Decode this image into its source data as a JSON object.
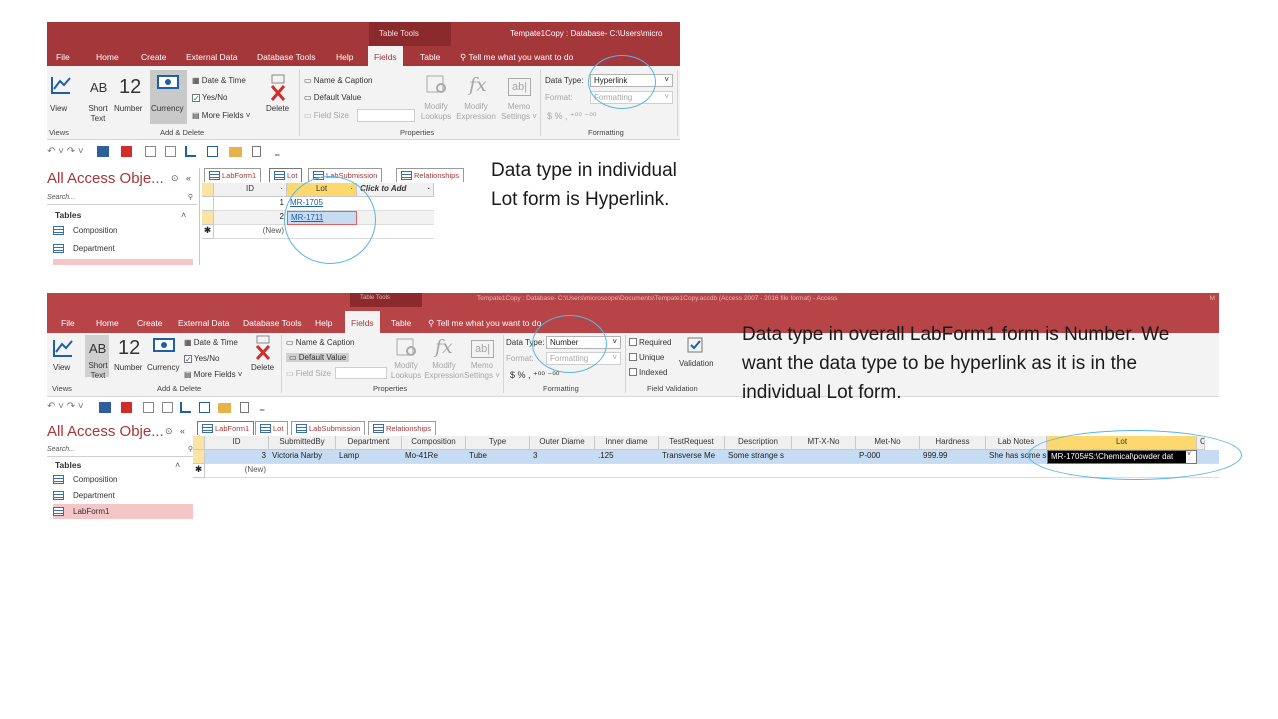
{
  "shot1": {
    "titlebar": {
      "table_tools": "Table Tools",
      "window_title": "Tempate1Copy : Database- C:\\Users\\micro"
    },
    "tabs": [
      "File",
      "Home",
      "Create",
      "External Data",
      "Database Tools",
      "Help",
      "Fields",
      "Table"
    ],
    "active_tab": "Fields",
    "tell_me": "Tell me what you want to do",
    "ribbon": {
      "view": "View",
      "short_text_ab": "AB",
      "short_text": "Short Text",
      "number_12": "12",
      "number": "Number",
      "currency": "Currency",
      "date_time": "Date & Time",
      "yes_no": "Yes/No",
      "more_fields": "More Fields ˅",
      "delete": "Delete",
      "name_caption": "Name & Caption",
      "default_value": "Default Value",
      "field_size": "Field Size",
      "modify_lookups": "Modify Lookups",
      "modify_expression": "Modify Expression",
      "memo_settings": "Memo Settings ˅",
      "fx": "fx",
      "ab_box": "ab|",
      "data_type_label": "Data Type:",
      "data_type_value": "Hyperlink",
      "format_label": "Format:",
      "format_value": "Formatting",
      "currency_symbols": "$  %  ,  ⁺⁰⁰ ⁻⁰⁰",
      "groups": {
        "views": "Views",
        "add_delete": "Add & Delete",
        "properties": "Properties",
        "formatting": "Formatting"
      }
    },
    "qat": "↶ ˅  ↷ ˅",
    "nav": {
      "title": "All Access Obje...",
      "search": "Search...",
      "tables": "Tables",
      "items": [
        "Composition",
        "Department"
      ]
    },
    "doc_tabs": [
      "LabForm1",
      "Lot",
      "LabSubmission",
      "Relationships"
    ],
    "grid": {
      "headers": [
        "ID",
        "Lot",
        "Click to Add"
      ],
      "rows": [
        {
          "id": "1",
          "lot": "MR-1705"
        },
        {
          "id": "2",
          "lot": "MR-1711"
        }
      ],
      "new_row": "(New)"
    }
  },
  "shot2": {
    "titlebar": {
      "table_tools": "Table Tools",
      "window_title": "Tempate1Copy : Database- C:\\Users\\microscope\\Documents\\Tempate1Copy.accdb (Access 2007 - 2016 file format) - Access",
      "user": "M"
    },
    "tabs": [
      "File",
      "Home",
      "Create",
      "External Data",
      "Database Tools",
      "Help",
      "Fields",
      "Table"
    ],
    "active_tab": "Fields",
    "tell_me": "Tell me what you want to do",
    "ribbon": {
      "view": "View",
      "short_text_ab": "AB",
      "short_text": "Short Text",
      "number_12": "12",
      "number": "Number",
      "currency": "Currency",
      "date_time": "Date & Time",
      "yes_no": "Yes/No",
      "more_fields": "More Fields ˅",
      "delete": "Delete",
      "name_caption": "Name & Caption",
      "default_value": "Default Value",
      "field_size": "Field Size",
      "modify_lookups": "Modify Lookups",
      "modify_expression": "Modify Expression",
      "memo_settings": "Memo Settings ˅",
      "fx": "fx",
      "ab_box": "ab|",
      "data_type_label": "Data Type:",
      "data_type_value": "Number",
      "format_label": "Format:",
      "format_value": "Formatting",
      "currency_symbols": "$  %  ,  ⁺⁰⁰ ⁻⁰⁰",
      "required": "Required",
      "unique": "Unique",
      "indexed": "Indexed",
      "validation": "Validation",
      "groups": {
        "views": "Views",
        "add_delete": "Add & Delete",
        "properties": "Properties",
        "formatting": "Formatting",
        "field_validation": "Field Validation"
      }
    },
    "qat": "↶ ˅  ↷ ˅",
    "nav": {
      "title": "All Access Obje...",
      "search": "Search...",
      "tables": "Tables",
      "items": [
        "Composition",
        "Department",
        "LabForm1"
      ]
    },
    "doc_tabs": [
      "LabForm1",
      "Lot",
      "LabSubmission",
      "Relationships"
    ],
    "grid": {
      "headers": [
        "ID",
        "SubmittedBy",
        "Department",
        "Composition",
        "Type",
        "Outer Diame",
        "Inner diame",
        "TestRequest",
        "Description",
        "MT-X-No",
        "Met-No",
        "Hardness",
        "Lab Notes",
        "Lot",
        "C"
      ],
      "row": [
        "3",
        "Victoria Narby",
        "Lamp",
        "Mo-41Re",
        "Tube",
        "3",
        ".125",
        "Transverse Me",
        "Some strange s",
        "",
        "P-000",
        "999.99",
        "She has some s",
        "MR-1705#S:\\Chemical\\powder dat",
        ""
      ],
      "new_row": "(New)"
    }
  },
  "annotations": {
    "note1": "Data type in individual Lot form is Hyperlink.",
    "note2": "Data type in overall LabForm1 form is Number. We want the data type to be hyperlink as it is in the individual Lot form."
  },
  "colors": {
    "access_red": "#a4373a",
    "highlight_yellow": "#fcd86e",
    "ellipse_blue": "#59b6e0",
    "link_blue": "#1f5fa8"
  }
}
